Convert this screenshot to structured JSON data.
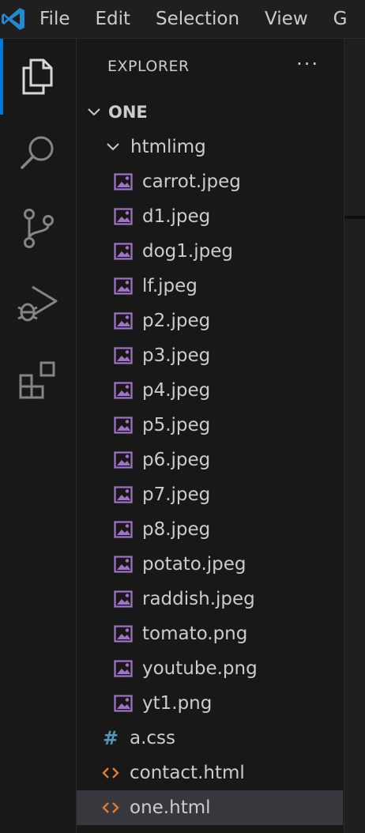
{
  "menu": [
    "File",
    "Edit",
    "Selection",
    "View",
    "G"
  ],
  "explorer": {
    "title": "EXPLORER",
    "more": "···",
    "root": "ONE",
    "folder": "htmlimg",
    "images": [
      "carrot.jpeg",
      "d1.jpeg",
      "dog1.jpeg",
      "lf.jpeg",
      "p2.jpeg",
      "p3.jpeg",
      "p4.jpeg",
      "p5.jpeg",
      "p6.jpeg",
      "p7.jpeg",
      "p8.jpeg",
      "potato.jpeg",
      "raddish.jpeg",
      "tomato.png",
      "youtube.png",
      "yt1.png"
    ],
    "css_file": "a.css",
    "html_files": [
      "contact.html",
      "one.html"
    ],
    "selected": "one.html"
  },
  "colors": {
    "accent": "#0078d4",
    "image_icon": "#a074c4",
    "css_icon": "#519aba",
    "html_icon": "#e37933"
  }
}
